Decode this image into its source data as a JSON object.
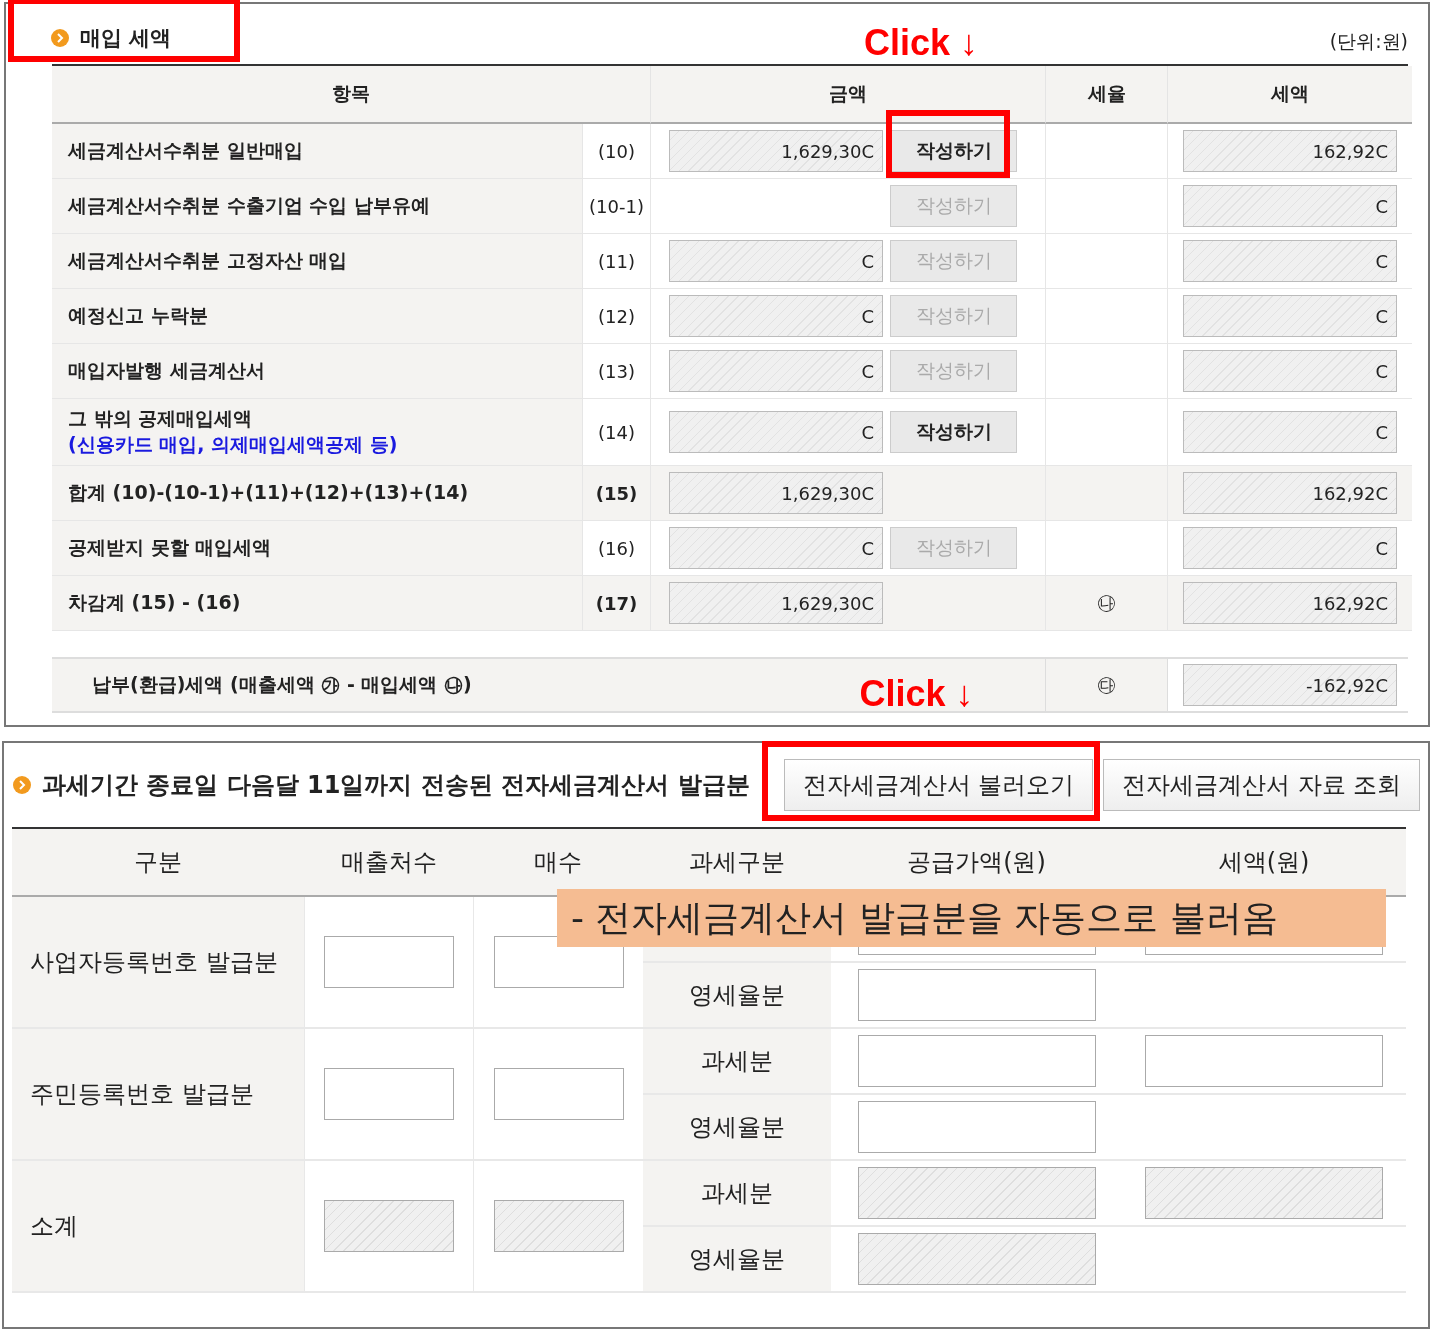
{
  "purchase_tax": {
    "title": "매입 세액",
    "title_highlighted": true,
    "unit": "(단위:원)",
    "columns": [
      "항목",
      "금액",
      "세율",
      "세액"
    ],
    "rows": [
      {
        "kind": "item",
        "label": "세금계산서수취분 일반매입",
        "code": "(10)",
        "amount": "1,629,30C",
        "button": {
          "label": "작성하기",
          "disabled": false,
          "highlighted": true
        },
        "tax": "162,92C"
      },
      {
        "kind": "item",
        "label": "세금계산서수취분 수출기업 수입 납부유예",
        "code": "(10-1)",
        "button": {
          "label": "작성하기",
          "disabled": true,
          "highlighted": false
        },
        "tax": "C"
      },
      {
        "kind": "item",
        "label": "세금계산서수취분 고정자산 매입",
        "code": "(11)",
        "amount": "C",
        "button": {
          "label": "작성하기",
          "disabled": true,
          "highlighted": false
        },
        "tax": "C"
      },
      {
        "kind": "item",
        "label": "예정신고 누락분",
        "code": "(12)",
        "amount": "C",
        "button": {
          "label": "작성하기",
          "disabled": true,
          "highlighted": false
        },
        "tax": "C"
      },
      {
        "kind": "item",
        "label": "매입자발행 세금계산서",
        "code": "(13)",
        "amount": "C",
        "button": {
          "label": "작성하기",
          "disabled": true,
          "highlighted": false
        },
        "tax": "C"
      },
      {
        "kind": "item",
        "label": "그 밖의 공제매입세액",
        "note": "(신용카드 매입, 의제매입세액공제 등)",
        "code": "(14)",
        "amount": "C",
        "button": {
          "label": "작성하기",
          "disabled": false,
          "highlighted": false
        },
        "tax": "C"
      },
      {
        "kind": "total",
        "label": "합계 (10)-(10-1)+(11)+(12)+(13)+(14)",
        "code": "(15)",
        "amount": "1,629,30C",
        "tax": "162,92C"
      },
      {
        "kind": "item",
        "label": "공제받지 못할 매입세액",
        "code": "(16)",
        "amount": "C",
        "button": {
          "label": "작성하기",
          "disabled": true,
          "highlighted": false
        },
        "tax": "C"
      },
      {
        "kind": "total",
        "label": "차감계 (15) - (16)",
        "code": "(17)",
        "amount": "1,629,30C",
        "rate": "㉯",
        "tax": "162,92C"
      }
    ],
    "payable": {
      "label": "납부(환급)세액 (매출세액 ㉮ - 매입세액 ㉯)",
      "rate": "㉰",
      "tax": "-162,92C"
    }
  },
  "annotations": [
    "Click ↓",
    "Click ↓"
  ],
  "e_invoice": {
    "title": "과세기간 종료일 다음달 11일까지 전송된 전자세금계산서 발급분",
    "buttons": [
      {
        "label": "전자세금계산서 불러오기",
        "highlighted": true
      },
      {
        "label": "전자세금계산서 자료 조회",
        "highlighted": false
      }
    ],
    "columns": [
      "구분",
      "매출처수",
      "매수",
      "과세구분",
      "공급가액(원)",
      "세액(원)"
    ],
    "groups": [
      {
        "label": "사업자등록번호 발급분",
        "disabled": false,
        "subrows": [
          {
            "has_tax": true
          },
          {
            "type": "영세율분",
            "has_tax": false
          }
        ]
      },
      {
        "label": "주민등록번호 발급분",
        "disabled": false,
        "subrows": [
          {
            "type": "과세분",
            "has_tax": true
          },
          {
            "type": "영세율분",
            "has_tax": false
          }
        ]
      },
      {
        "label": "소계",
        "disabled": true,
        "subrows": [
          {
            "type": "과세분",
            "has_tax": true
          },
          {
            "type": "영세율분",
            "has_tax": false
          }
        ]
      }
    ],
    "callout": "- 전자세금계산서 발급분을 자동으로 불러옴"
  }
}
